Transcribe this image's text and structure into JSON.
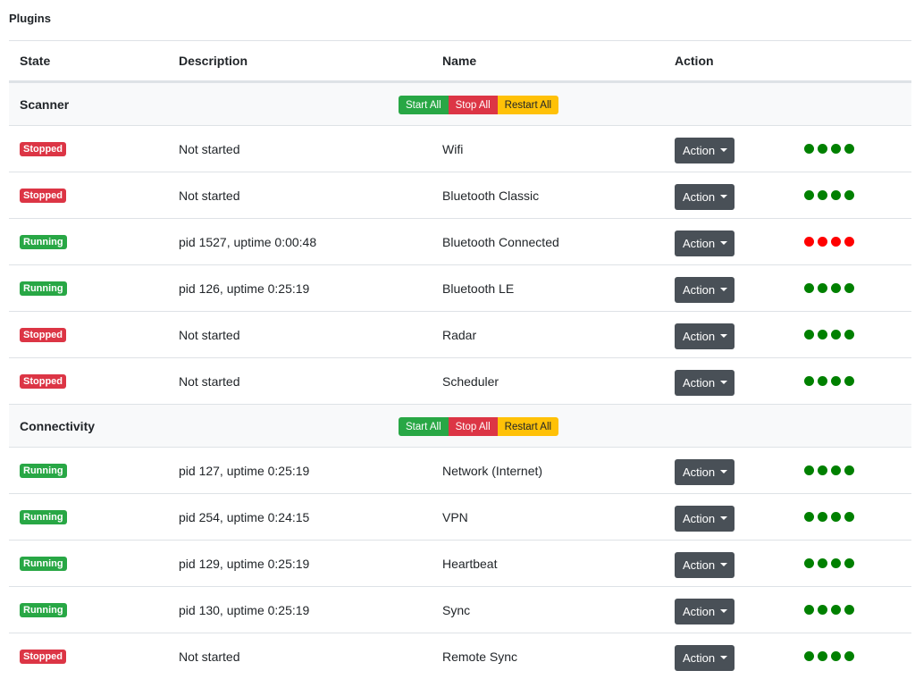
{
  "page": {
    "title": "Plugins"
  },
  "columns": {
    "state": "State",
    "description": "Description",
    "name": "Name",
    "action": "Action"
  },
  "group_buttons": {
    "start": "Start All",
    "stop": "Stop All",
    "restart": "Restart All"
  },
  "action_label": "Action",
  "colors": {
    "running": "#28a745",
    "stopped": "#dc3545",
    "dot_ok": "#008000",
    "dot_error": "#ff0000"
  },
  "groups": [
    {
      "label": "Scanner",
      "rows": [
        {
          "state": "Stopped",
          "description": "Not started",
          "name": "Wifi",
          "dots": [
            "ok",
            "ok",
            "ok",
            "ok"
          ]
        },
        {
          "state": "Stopped",
          "description": "Not started",
          "name": "Bluetooth Classic",
          "dots": [
            "ok",
            "ok",
            "ok",
            "ok"
          ]
        },
        {
          "state": "Running",
          "description": "pid 1527, uptime 0:00:48",
          "name": "Bluetooth Connected",
          "dots": [
            "error",
            "error",
            "error",
            "error"
          ]
        },
        {
          "state": "Running",
          "description": "pid 126, uptime 0:25:19",
          "name": "Bluetooth LE",
          "dots": [
            "ok",
            "ok",
            "ok",
            "ok"
          ]
        },
        {
          "state": "Stopped",
          "description": "Not started",
          "name": "Radar",
          "dots": [
            "ok",
            "ok",
            "ok",
            "ok"
          ]
        },
        {
          "state": "Stopped",
          "description": "Not started",
          "name": "Scheduler",
          "dots": [
            "ok",
            "ok",
            "ok",
            "ok"
          ]
        }
      ]
    },
    {
      "label": "Connectivity",
      "rows": [
        {
          "state": "Running",
          "description": "pid 127, uptime 0:25:19",
          "name": "Network (Internet)",
          "dots": [
            "ok",
            "ok",
            "ok",
            "ok"
          ]
        },
        {
          "state": "Running",
          "description": "pid 254, uptime 0:24:15",
          "name": "VPN",
          "dots": [
            "ok",
            "ok",
            "ok",
            "ok"
          ]
        },
        {
          "state": "Running",
          "description": "pid 129, uptime 0:25:19",
          "name": "Heartbeat",
          "dots": [
            "ok",
            "ok",
            "ok",
            "ok"
          ]
        },
        {
          "state": "Running",
          "description": "pid 130, uptime 0:25:19",
          "name": "Sync",
          "dots": [
            "ok",
            "ok",
            "ok",
            "ok"
          ]
        },
        {
          "state": "Stopped",
          "description": "Not started",
          "name": "Remote Sync",
          "dots": [
            "ok",
            "ok",
            "ok",
            "ok"
          ]
        }
      ]
    }
  ]
}
